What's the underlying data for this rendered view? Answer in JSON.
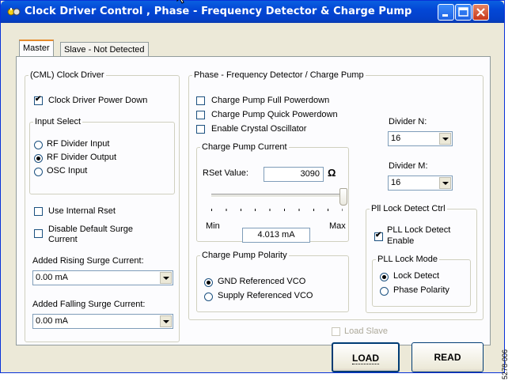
{
  "window": {
    "title": "Clock Driver Control , Phase - Frequency Detector & Charge Pump",
    "icon": "app-icon",
    "controls": [
      "minimize-icon",
      "maximize-icon",
      "close-icon"
    ]
  },
  "tabs": [
    {
      "label": "Master",
      "active": true
    },
    {
      "label": "Slave - Not Detected",
      "active": false
    }
  ],
  "clock_driver": {
    "title": "(CML) Clock Driver",
    "power_down": {
      "label": "Clock Driver Power Down",
      "checked": true
    },
    "input_select": {
      "title": "Input Select",
      "options": [
        {
          "label": "RF Divider Input",
          "selected": false
        },
        {
          "label": "RF Divider Output",
          "selected": true
        },
        {
          "label": "OSC Input",
          "selected": false
        }
      ]
    },
    "use_internal_rset": {
      "label": "Use Internal Rset",
      "checked": false
    },
    "disable_surge_line1": "Disable Default Surge",
    "disable_surge_line2": "Current",
    "disable_surge_checked": false,
    "rising_label": "Added Rising Surge Current:",
    "rising_value": "0.00 mA",
    "falling_label": "Added Falling Surge Current:",
    "falling_value": "0.00 mA"
  },
  "pfd": {
    "title": "Phase - Frequency Detector / Charge Pump",
    "checks": [
      {
        "label": "Charge Pump Full Powerdown",
        "checked": false
      },
      {
        "label": "Charge Pump Quick Powerdown",
        "checked": false
      },
      {
        "label": "Enable Crystal Oscillator",
        "checked": false
      }
    ],
    "cp_current": {
      "title": "Charge Pump Current",
      "rset_label": "RSet Value:",
      "rset_value": "3090",
      "unit": "Ω",
      "slider_level": 1.0,
      "min_label": "Min",
      "max_label": "Max",
      "current_value": "4.013 mA"
    },
    "polarity": {
      "title": "Charge Pump Polarity",
      "options": [
        {
          "label": "GND Referenced VCO",
          "selected": true
        },
        {
          "label": "Supply Referenced VCO",
          "selected": false
        }
      ]
    },
    "divider_n_label": "Divider N:",
    "divider_n_value": "16",
    "divider_m_label": "Divider M:",
    "divider_m_value": "16",
    "lock_detect": {
      "title": "Pll Lock Detect Ctrl",
      "enable_line1": "PLL Lock Detect",
      "enable_line2": "Enable",
      "enable_checked": true,
      "mode_title": "PLL Lock Mode",
      "modes": [
        {
          "label": "Lock Detect",
          "selected": true
        },
        {
          "label": "Phase Polarity",
          "selected": false
        }
      ]
    }
  },
  "load_slave": {
    "label": "Load Slave",
    "checked": false,
    "enabled": false
  },
  "buttons": {
    "load": "LOAD",
    "read": "READ"
  },
  "side_note": "5278-006"
}
